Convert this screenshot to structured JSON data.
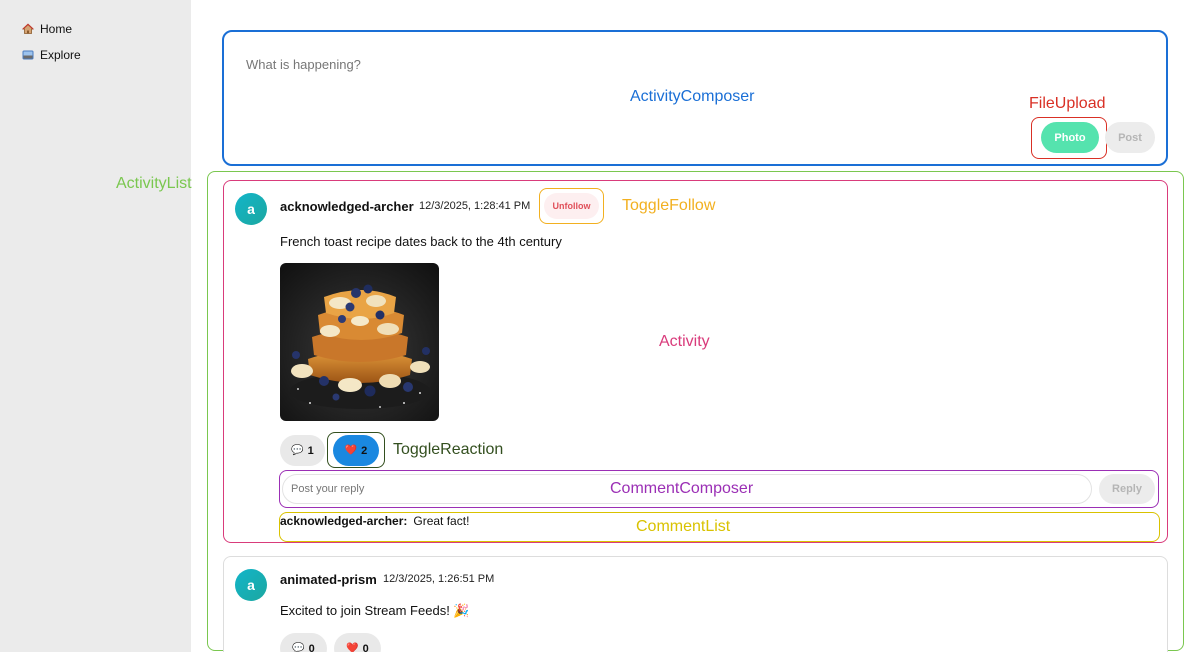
{
  "sidebar": {
    "items": [
      {
        "label": "Home",
        "icon": "home-icon"
      },
      {
        "label": "Explore",
        "icon": "explore-icon"
      }
    ]
  },
  "labels": {
    "activity_composer": "ActivityComposer",
    "file_upload": "FileUpload",
    "activity_list": "ActivityList",
    "toggle_follow": "ToggleFollow",
    "activity": "Activity",
    "toggle_reaction": "ToggleReaction",
    "comment_composer": "CommentComposer",
    "comment_list": "CommentList"
  },
  "composer": {
    "placeholder": "What is happening?",
    "photo_label": "Photo",
    "post_label": "Post"
  },
  "activities": [
    {
      "avatar_letter": "a",
      "username": "acknowledged-archer",
      "timestamp": "12/3/2025, 1:28:41 PM",
      "follow_label": "Unfollow",
      "text": "French toast recipe dates back to the 4th century",
      "comment_count": "1",
      "reaction_count": "2",
      "reply_placeholder": "Post your reply",
      "reply_label": "Reply",
      "comments": [
        {
          "author": "acknowledged-archer:",
          "text": "Great fact!"
        }
      ]
    },
    {
      "avatar_letter": "a",
      "username": "animated-prism",
      "timestamp": "12/3/2025, 1:26:51 PM",
      "text": "Excited to join Stream Feeds! 🎉",
      "comment_count": "0",
      "reaction_count": "0"
    }
  ],
  "colors": {
    "composer_border": "#1a6fd6",
    "file_upload": "#d93025",
    "activity_list": "#7ac74f",
    "toggle_follow": "#f2b020",
    "activity": "#d93b7b",
    "toggle_reaction": "#334f1f",
    "comment_composer": "#9b2fb5",
    "comment_list": "#d9c200",
    "photo_button": "#55e3ae",
    "reaction_active": "#1a88e0"
  }
}
